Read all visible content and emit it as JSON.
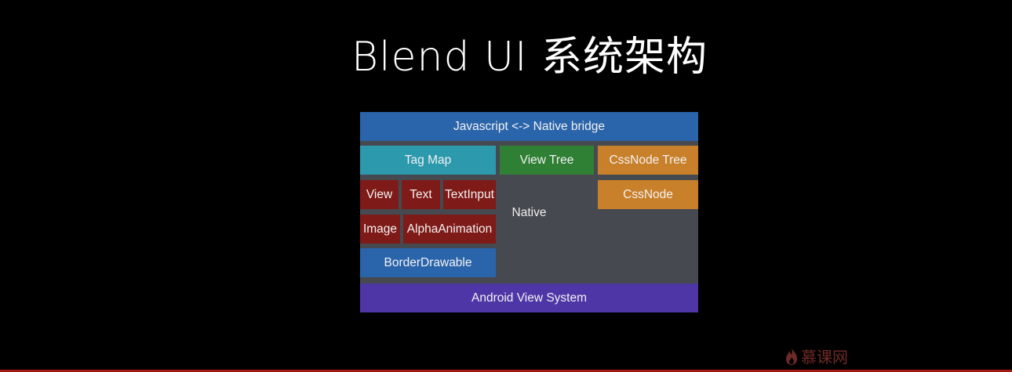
{
  "slide": {
    "title": "Blend UI 系统架构"
  },
  "diagram": {
    "bridge": "Javascript <-> Native bridge",
    "tag_map": "Tag Map",
    "view_tree": "View Tree",
    "cssnode_tree": "CssNode Tree",
    "cssnode": "CssNode",
    "view": "View",
    "text": "Text",
    "text_input": "TextInput",
    "image": "Image",
    "alpha_animation": "AlphaAnimation",
    "border_drawable": "BorderDrawable",
    "native": "Native",
    "android_view_system": "Android View System"
  },
  "watermark": {
    "text": "慕课网"
  },
  "colors": {
    "bridge": "#2a64aa",
    "tag_map": "#2c99ad",
    "view_tree": "#2f7f34",
    "cssnode": "#c9802a",
    "components": "#7e1a17",
    "android": "#4f36a7",
    "native_bg": "#46494f"
  }
}
